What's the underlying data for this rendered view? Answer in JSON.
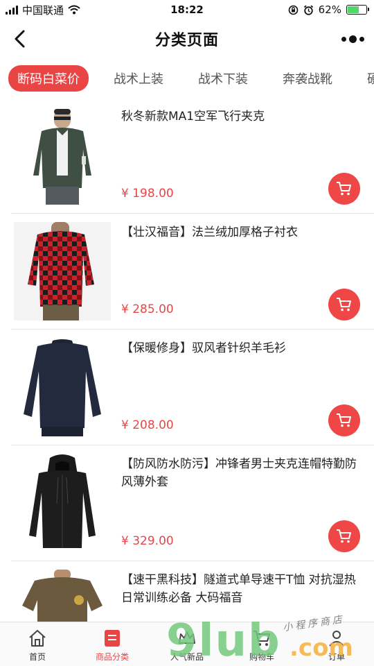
{
  "status_bar": {
    "carrier": "中国联通",
    "time": "18:22",
    "battery": "62%",
    "battery_level": 0.62
  },
  "nav": {
    "title": "分类页面"
  },
  "tabs": [
    {
      "label": "断码白菜价",
      "active": true
    },
    {
      "label": "战术上装",
      "active": false
    },
    {
      "label": "战术下装",
      "active": false
    },
    {
      "label": "奔袭战靴",
      "active": false
    },
    {
      "label": "硬",
      "active": false
    }
  ],
  "products": [
    {
      "title": "秋冬新款MA1空军飞行夹克",
      "price": "¥ 198.00",
      "image": "bomber-jacket"
    },
    {
      "title": "【壮汉福音】法兰绒加厚格子衬衣",
      "price": "¥ 285.00",
      "image": "plaid-shirt"
    },
    {
      "title": "【保暖修身】驭风者针织羊毛衫",
      "price": "¥ 208.00",
      "image": "knit-sweater"
    },
    {
      "title": "【防风防水防污】冲锋者男士夹克连帽特勤防风薄外套",
      "price": "¥ 329.00",
      "image": "hooded-jacket"
    },
    {
      "title": "【速干黑科技】隧道式单导速干T恤 对抗湿热 日常训练必备 大码福音",
      "price": "",
      "image": "tshirt"
    }
  ],
  "tabbar": [
    {
      "label": "首页",
      "icon": "home-icon",
      "active": false
    },
    {
      "label": "商品分类",
      "icon": "category-icon",
      "active": true
    },
    {
      "label": "人气新品",
      "icon": "crown-icon",
      "active": false
    },
    {
      "label": "购物车",
      "icon": "cart-icon",
      "active": false
    },
    {
      "label": "订单",
      "icon": "user-icon",
      "active": false
    }
  ],
  "watermark": {
    "main": "9lub",
    "domain": ".com",
    "tagline": "小程序商店"
  },
  "colors": {
    "accent": "#e94545",
    "battery": "#4cd964"
  }
}
